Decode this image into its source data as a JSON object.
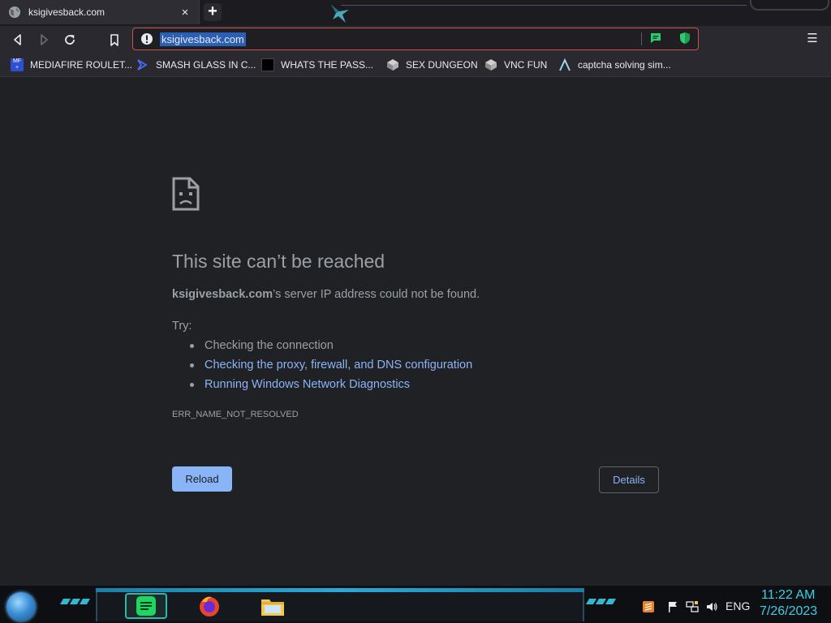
{
  "browser": {
    "tab": {
      "title": "ksigivesback.com",
      "close_glyph": "×",
      "favicon": "globe-icon"
    },
    "new_tab_glyph": "+",
    "toolbar": {
      "back": "back-arrow-icon",
      "forward": "forward-arrow-icon",
      "reload": "reload-icon",
      "bookmark": "bookmark-icon",
      "menu_glyph": "☰"
    },
    "omnibox": {
      "url": "ksigivesback.com",
      "security_icon": "info-warning-icon",
      "border_color": "#c4564a"
    },
    "bookmarks": [
      {
        "label": "MEDIAFIRE ROULET...",
        "icon": "mediafire-icon"
      },
      {
        "label": "SMASH GLASS IN C...",
        "icon": "chevron-logo-icon"
      },
      {
        "label": "WHATS THE PASS...",
        "icon": "black-square-icon"
      },
      {
        "label": "SEX DUNGEON",
        "icon": "cube-icon"
      },
      {
        "label": "VNC FUN",
        "icon": "cube-icon"
      },
      {
        "label": "captcha solving sim...",
        "icon": "lambda-icon"
      }
    ]
  },
  "error_page": {
    "title": "This site can’t be reached",
    "host": "ksigivesback.com",
    "description_suffix": "’s server IP address could not be found.",
    "try_label": "Try:",
    "suggestions": [
      "Checking the connection",
      "Checking the proxy, firewall, and DNS configuration",
      "Running Windows Network Diagnostics"
    ],
    "error_code": "ERR_NAME_NOT_RESOLVED",
    "reload_label": "Reload",
    "details_label": "Details",
    "link_color": "#8ab4f8"
  },
  "taskbar": {
    "apps": [
      "spotify-icon",
      "firefox-icon",
      "file-explorer-icon"
    ],
    "tray": {
      "language": "ENG",
      "time": "11:22 AM",
      "date": "7/26/2023"
    },
    "accent_color": "#3ecfe0"
  }
}
